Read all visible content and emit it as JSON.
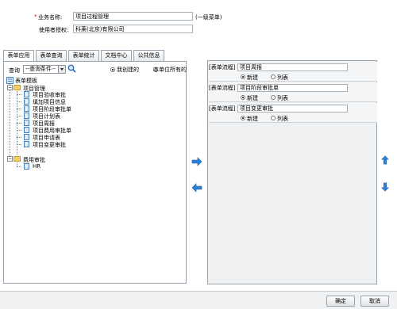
{
  "form": {
    "name_required_mark": "*",
    "name_label": "业务名称:",
    "name_value": "项目过程管理",
    "name_hint": "(一级菜单)",
    "auth_label": "使用者授权:",
    "auth_value": "科莱(北京)有限公司"
  },
  "tabs": [
    {
      "label": "表单应用",
      "active": true
    },
    {
      "label": "表单查询",
      "active": false
    },
    {
      "label": "表单统计",
      "active": false
    },
    {
      "label": "文档中心",
      "active": false
    },
    {
      "label": "公共信息",
      "active": false
    }
  ],
  "query": {
    "label": "查询",
    "select_value": "--查询条件--",
    "radio_mine": "我创建的",
    "radio_unit": "本单位所有的"
  },
  "tree": {
    "root": "表单模板",
    "groups": [
      {
        "label": "项目管理",
        "items": [
          "项目验收审批",
          "填加项目信息",
          "项目阶段审批单",
          "项目计划表",
          "项目周报",
          "项目费用审批单",
          "项目申请表",
          "项目变更审批"
        ]
      },
      {
        "label": "费用审批",
        "items": [
          "HR"
        ]
      }
    ]
  },
  "selected": [
    {
      "type_label": "[表单流程]",
      "name": "项目周报",
      "radio_new": "新建",
      "radio_list": "列表"
    },
    {
      "type_label": "[表单流程]",
      "name": "项目阶段审批单",
      "radio_new": "新建",
      "radio_list": "列表"
    },
    {
      "type_label": "[表单流程]",
      "name": "项目变更审批",
      "radio_new": "新建",
      "radio_list": "列表"
    }
  ],
  "footer": {
    "ok_label": "确定",
    "cancel_label": "取消"
  },
  "colors": {
    "accent_arrow": "#2f7fd6",
    "required": "#d00000"
  }
}
